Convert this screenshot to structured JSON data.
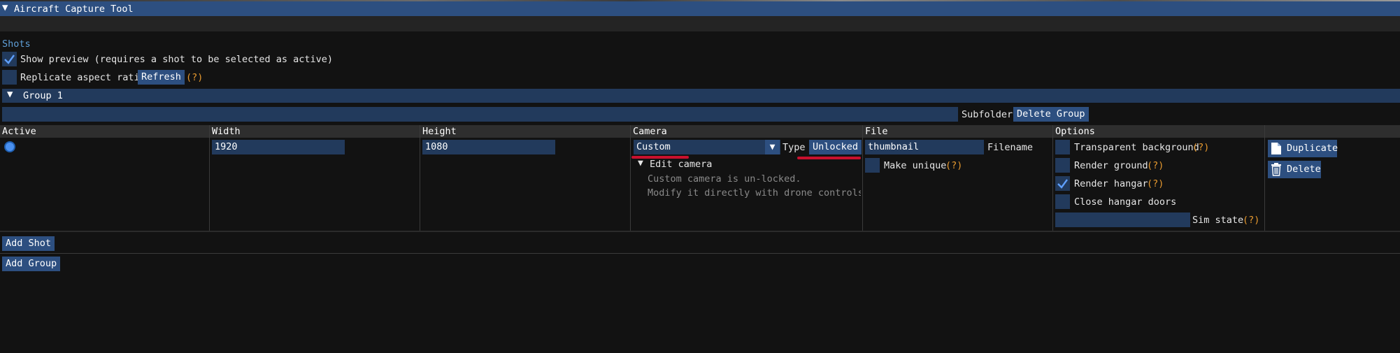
{
  "window": {
    "title": "Aircraft Capture Tool"
  },
  "shots_section": {
    "label": "Shots",
    "show_preview": {
      "label": "Show preview (requires a shot to be selected as active)",
      "checked": true
    },
    "replicate_aspect": {
      "label": "Replicate aspect ratio",
      "checked": false
    },
    "refresh_label": "Refresh",
    "help": "(?)"
  },
  "group": {
    "title": "Group 1",
    "subfolder_value": "",
    "subfolder_label": "Subfolder",
    "delete_group_label": "Delete Group"
  },
  "table": {
    "headers": [
      "Active",
      "Width",
      "Height",
      "Camera",
      "File",
      "Options"
    ],
    "row": {
      "active": true,
      "width": "1920",
      "height": "1080",
      "camera": {
        "value": "Custom",
        "type_label": "Type",
        "type_value": "Unlocked",
        "edit_label": "Edit camera",
        "note_1": "Custom camera is un-locked.",
        "note_2": "Modify it directly with drone controls, or"
      },
      "file": {
        "filename_value": "thumbnail",
        "filename_label": "Filename",
        "make_unique_label": "Make unique",
        "make_unique_checked": false
      },
      "options": {
        "transparent_background": {
          "label": "Transparent background",
          "checked": false
        },
        "render_ground": {
          "label": "Render ground",
          "checked": false
        },
        "render_hangar": {
          "label": "Render hangar",
          "checked": true
        },
        "close_hangar_doors": {
          "label": "Close hangar doors",
          "checked": false
        },
        "sim_state_value": "",
        "sim_state_label": "Sim state"
      },
      "actions": {
        "duplicate_label": "Duplicate",
        "delete_label": "Delete"
      }
    }
  },
  "add_shot_label": "Add Shot",
  "add_group_label": "Add Group",
  "colors": {
    "accent": "#2d4f80",
    "frame_bg": "#223a5c",
    "help_orange": "#e89a2f",
    "annotation_red": "#c8102e",
    "label_blue": "#5f9fd8"
  }
}
